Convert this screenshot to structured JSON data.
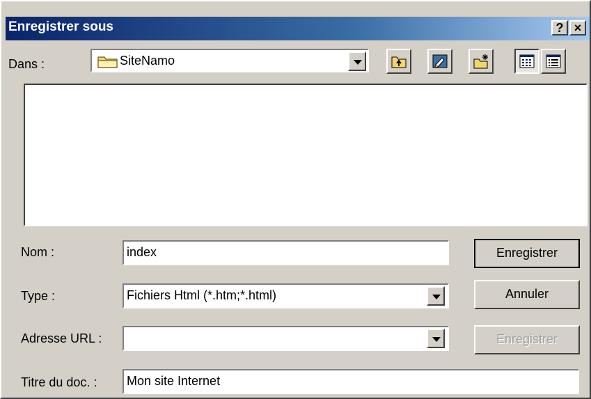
{
  "dialog": {
    "title": "Enregistrer sous",
    "help_label": "?",
    "close_label": "×"
  },
  "location": {
    "label": "Dans :",
    "folder": "SiteNamo"
  },
  "fields": {
    "name_label": "Nom :",
    "name_value": "index",
    "type_label": "Type :",
    "type_value": "Fichiers Html (*.htm;*.html)",
    "url_label": "Adresse URL :",
    "url_value": "",
    "doc_title_label": "Titre du doc. :",
    "doc_title_value": "Mon site Internet"
  },
  "buttons": {
    "save": "Enregistrer",
    "cancel": "Annuler",
    "save_url": "Enregistrer"
  },
  "icons": {
    "folder": "folder-icon",
    "up_folder": "up-folder-icon",
    "desktop": "desktop-icon",
    "new_folder": "new-folder-icon",
    "list_view": "list-view-icon",
    "details_view": "details-view-icon"
  }
}
